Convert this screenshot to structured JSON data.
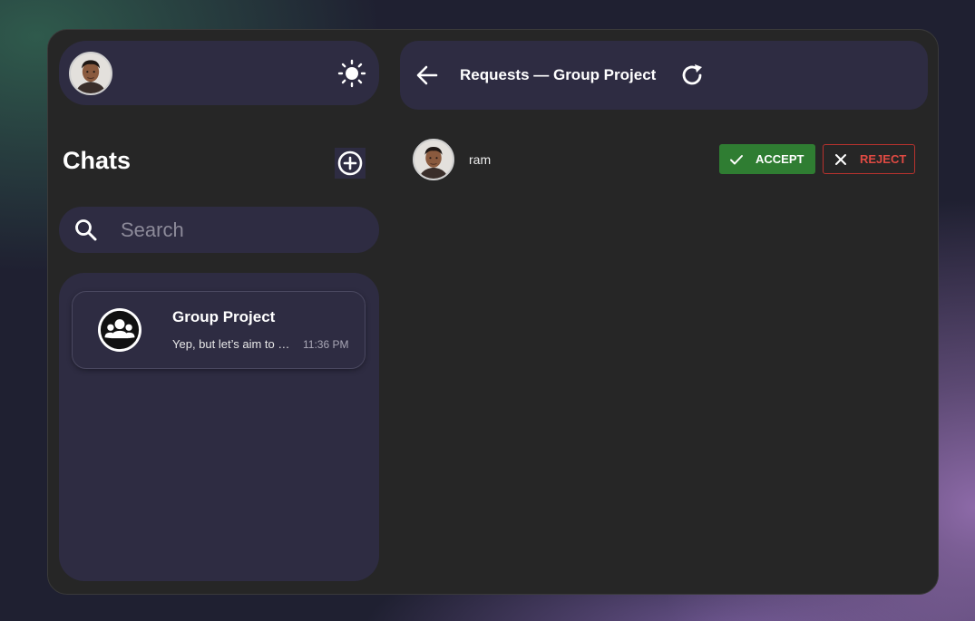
{
  "sidebar": {
    "chats_title": "Chats",
    "search": {
      "placeholder": "Search",
      "value": ""
    },
    "chats": [
      {
        "name": "Group Project",
        "preview": "Yep, but let’s aim to finish early",
        "time": "11:36 PM"
      }
    ]
  },
  "header": {
    "title": "Requests — Group Project"
  },
  "requests": [
    {
      "name": "ram",
      "accept_label": "ACCEPT",
      "reject_label": "REJECT"
    }
  ],
  "colors": {
    "panel": "#2e2c42",
    "app_bg": "#262626",
    "accept": "#2f7d32",
    "reject": "#e04a43"
  },
  "icons": {
    "theme": "sun-icon",
    "add_chat": "add-circle-icon",
    "search": "search-icon",
    "back": "arrow-left-icon",
    "refresh": "refresh-icon",
    "accept": "check-icon",
    "reject": "close-icon"
  }
}
